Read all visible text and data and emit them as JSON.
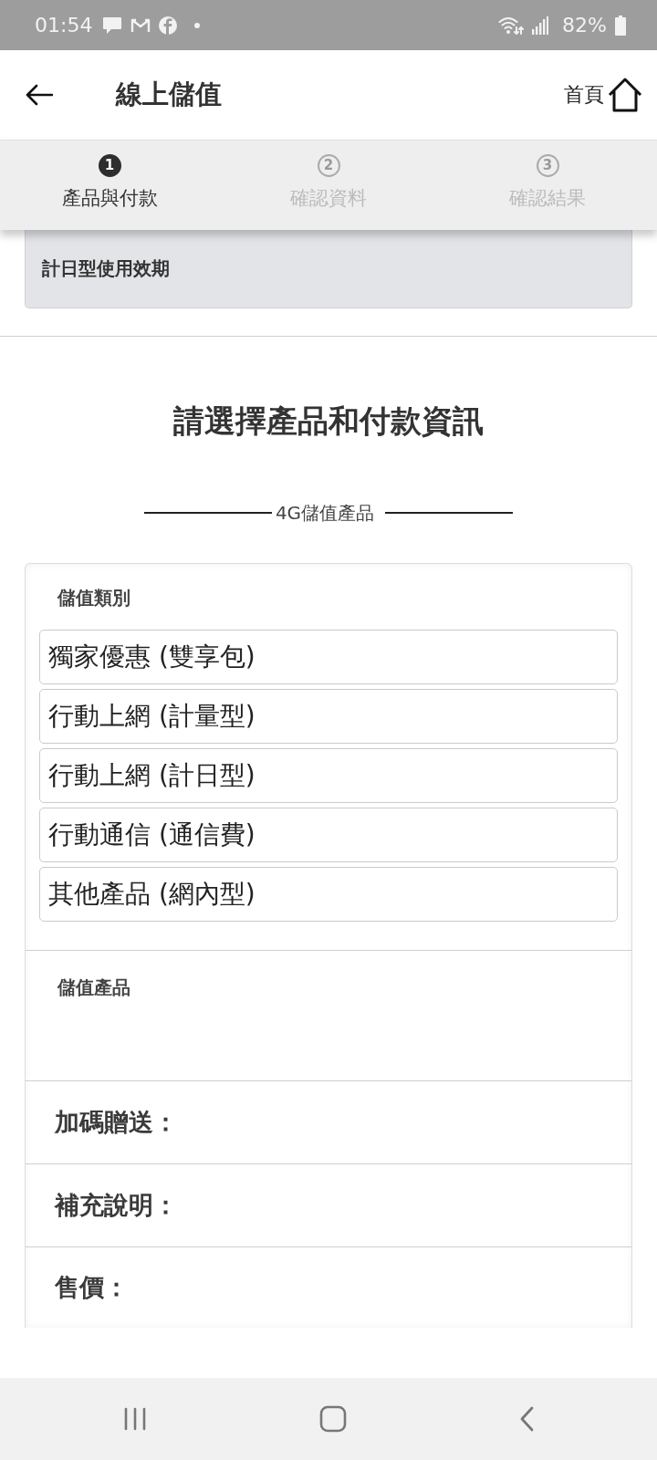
{
  "status_bar": {
    "time": "01:54",
    "battery": "82%"
  },
  "header": {
    "title": "線上儲值",
    "home_label": "首頁"
  },
  "steps": [
    {
      "number": "1",
      "label": "產品與付款",
      "current": true
    },
    {
      "number": "2",
      "label": "確認資料",
      "current": false
    },
    {
      "number": "3",
      "label": "確認結果",
      "current": false
    }
  ],
  "expiry_panel": {
    "label": "計日型使用效期"
  },
  "heading": "請選擇產品和付款資訊",
  "section_title": "4G儲值產品",
  "category": {
    "label": "儲值類別",
    "options": [
      {
        "label": "獨家優惠 (雙享包)",
        "selected": false
      },
      {
        "label": "行動上網 (計量型)",
        "selected": false
      },
      {
        "label": "行動上網 (計日型)",
        "selected": false
      },
      {
        "label": "行動通信 (通信費)",
        "selected": false
      },
      {
        "label": "其他產品 (網內型)",
        "selected": false
      }
    ]
  },
  "product": {
    "label": "儲值產品"
  },
  "details": [
    {
      "label": "加碼贈送："
    },
    {
      "label": "補充說明："
    },
    {
      "label": "售價："
    }
  ]
}
